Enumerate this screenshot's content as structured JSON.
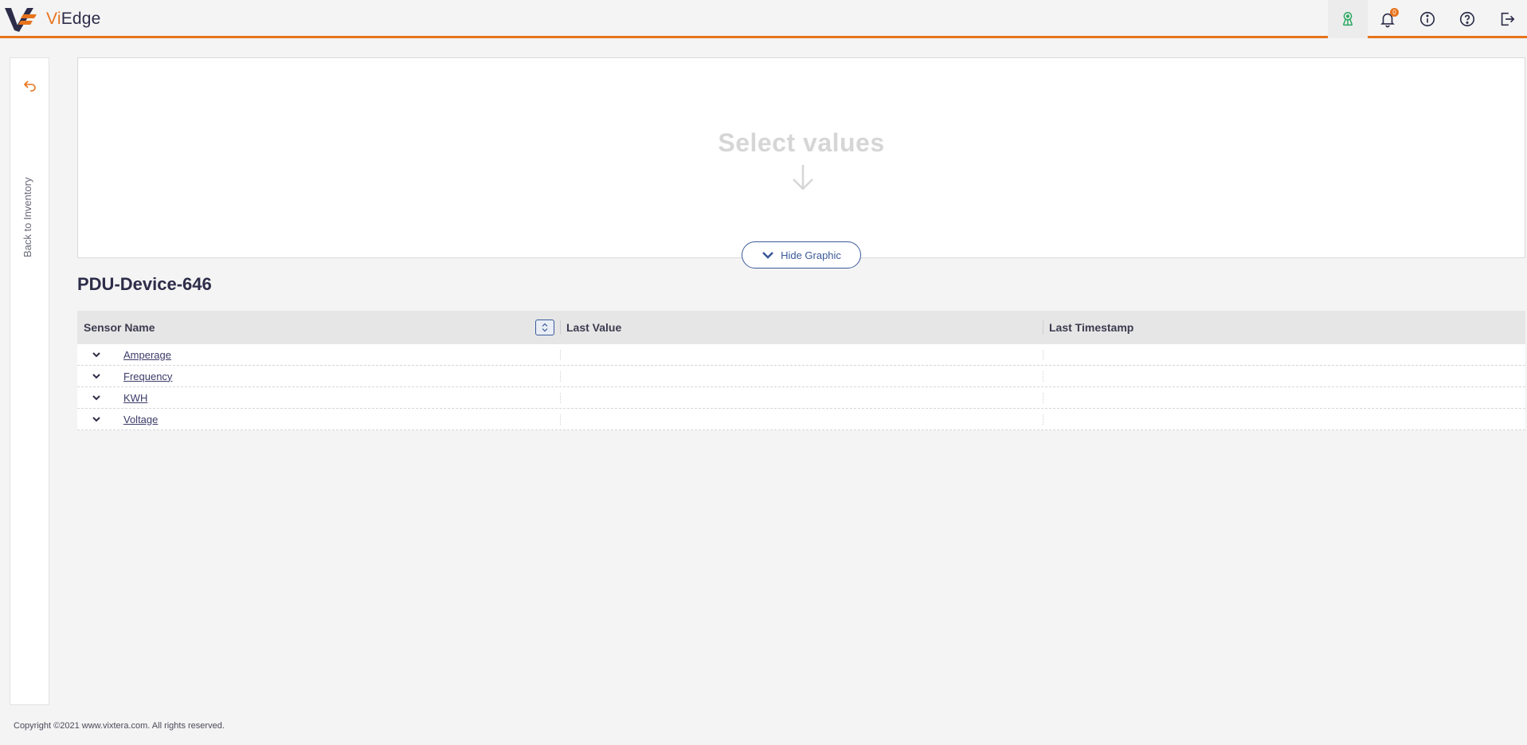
{
  "app": {
    "brand_prefix": "Vi",
    "brand_suffix": "Edge",
    "accent_color": "#e8731c",
    "text_color": "#2d2d4a"
  },
  "header": {
    "icons": [
      {
        "name": "network-icon",
        "active": true
      },
      {
        "name": "bell-icon",
        "badge": "0"
      },
      {
        "name": "info-icon"
      },
      {
        "name": "help-icon"
      },
      {
        "name": "logout-icon"
      }
    ]
  },
  "sidebar": {
    "back_label": "Back to Inventory",
    "back_icon": "back-arrow-icon"
  },
  "graphic": {
    "placeholder": "Select values",
    "hide_button_label": "Hide Graphic"
  },
  "device": {
    "title": "PDU-Device-646"
  },
  "table": {
    "columns": [
      "Sensor Name",
      "Last Value",
      "Last Timestamp"
    ],
    "rows": [
      {
        "name": "Amperage",
        "last_value": "",
        "last_timestamp": ""
      },
      {
        "name": "Frequency",
        "last_value": "",
        "last_timestamp": ""
      },
      {
        "name": "KWH",
        "last_value": "",
        "last_timestamp": ""
      },
      {
        "name": "Voltage",
        "last_value": "",
        "last_timestamp": ""
      }
    ]
  },
  "footer": {
    "copyright": "Copyright ©2021 www.vixtera.com. All rights reserved."
  }
}
